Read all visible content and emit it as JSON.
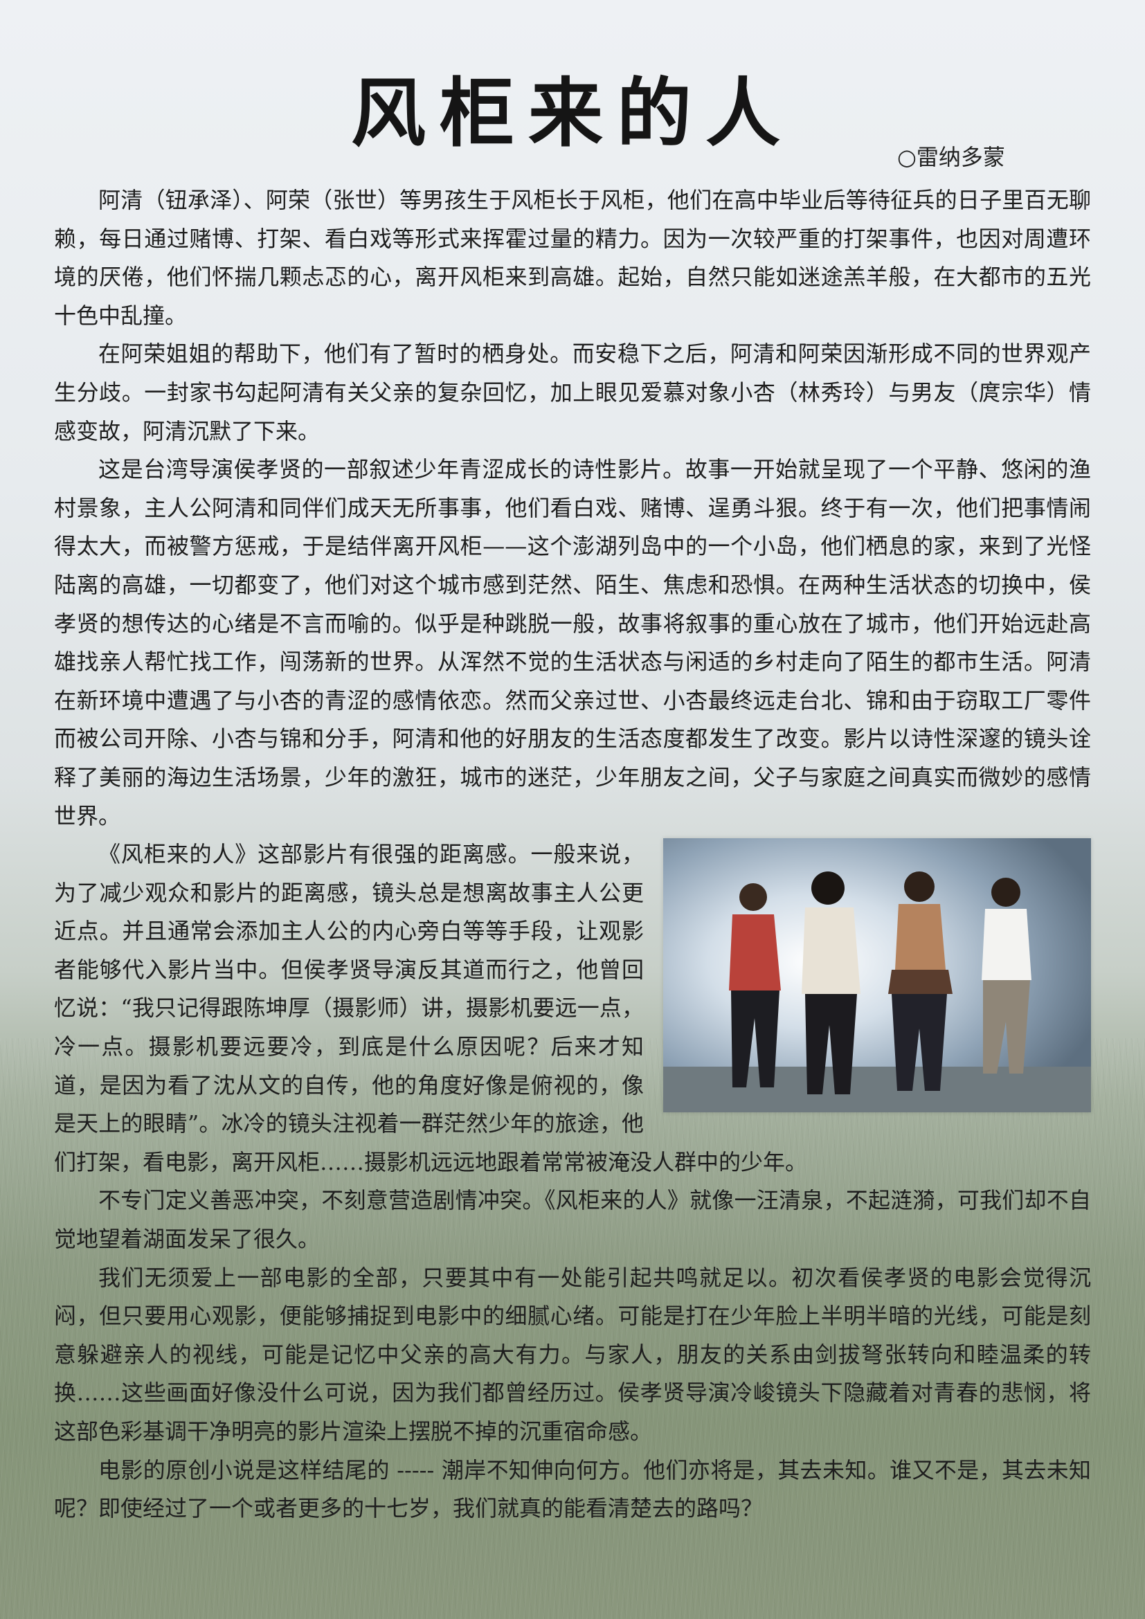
{
  "title": "风柜来的人",
  "author": "○雷纳多蒙",
  "photo": {
    "icon": "four-boys-in-sea-spray-photo"
  },
  "paragraphs": [
    "阿清（钮承泽）、阿荣（张世）等男孩生于风柜长于风柜，他们在高中毕业后等待征兵的日子里百无聊赖，每日通过赌博、打架、看白戏等形式来挥霍过量的精力。因为一次较严重的打架事件，也因对周遭环境的厌倦，他们怀揣几颗忐忑的心，离开风柜来到高雄。起始，自然只能如迷途羔羊般，在大都市的五光十色中乱撞。",
    "在阿荣姐姐的帮助下，他们有了暂时的栖身处。而安稳下之后，阿清和阿荣因渐形成不同的世界观产生分歧。一封家书勾起阿清有关父亲的复杂回忆，加上眼见爱慕对象小杏（林秀玲）与男友（庹宗华）情感变故，阿清沉默了下来。",
    " 这是台湾导演侯孝贤的一部叙述少年青涩成长的诗性影片。故事一开始就呈现了一个平静、悠闲的渔村景象，主人公阿清和同伴们成天无所事事，他们看白戏、赌博、逞勇斗狠。终于有一次，他们把事情闹得太大，而被警方惩戒，于是结伴离开风柜——这个澎湖列岛中的一个小岛，他们栖息的家，来到了光怪陆离的高雄，一切都变了，他们对这个城市感到茫然、陌生、焦虑和恐惧。在两种生活状态的切换中，侯孝贤的想传达的心绪是不言而喻的。似乎是种跳脱一般，故事将叙事的重心放在了城市，他们开始远赴高雄找亲人帮忙找工作，闯荡新的世界。从浑然不觉的生活状态与闲适的乡村走向了陌生的都市生活。阿清在新环境中遭遇了与小杏的青涩的感情依恋。然而父亲过世、小杏最终远走台北、锦和由于窃取工厂零件而被公司开除、小杏与锦和分手，阿清和他的好朋友的生活态度都发生了改变。影片以诗性深邃的镜头诠释了美丽的海边生活场景，少年的激狂，城市的迷茫，少年朋友之间，父子与家庭之间真实而微妙的感情世界。",
    " 《风柜来的人》这部影片有很强的距离感。一般来说，为了减少观众和影片的距离感，镜头总是想离故事主人公更近点。并且通常会添加主人公的内心旁白等等手段，让观影者能够代入影片当中。但侯孝贤导演反其道而行之，他曾回忆说：“我只记得跟陈坤厚（摄影师）讲，摄影机要远一点，冷一点。摄影机要远要冷，到底是什么原因呢？后来才知道，是因为看了沈从文的自传，他的角度好像是俯视的，像是天上的眼睛”。冰冷的镜头注视着一群茫然少年的旅途，他们打架，看电影，离开风柜……摄影机远远地跟着常常被淹没人群中的少年。",
    "不专门定义善恶冲突，不刻意营造剧情冲突。《风柜来的人》就像一汪清泉，不起涟漪，可我们却不自觉地望着湖面发呆了很久。",
    "我们无须爱上一部电影的全部，只要其中有一处能引起共鸣就足以。初次看侯孝贤的电影会觉得沉闷，但只要用心观影，便能够捕捉到电影中的细腻心绪。可能是打在少年脸上半明半暗的光线，可能是刻意躲避亲人的视线，可能是记忆中父亲的高大有力。与家人，朋友的关系由剑拔弩张转向和睦温柔的转换……这些画面好像没什么可说，因为我们都曾经历过。侯孝贤导演冷峻镜头下隐藏着对青春的悲悯，将这部色彩基调干净明亮的影片渲染上摆脱不掉的沉重宿命感。",
    "电影的原创小说是这样结尾的 ----- 潮岸不知伸向何方。他们亦将是，其去未知。谁又不是，其去未知呢？即使经过了一个或者更多的十七岁，我们就真的能看清楚去的路吗？"
  ]
}
